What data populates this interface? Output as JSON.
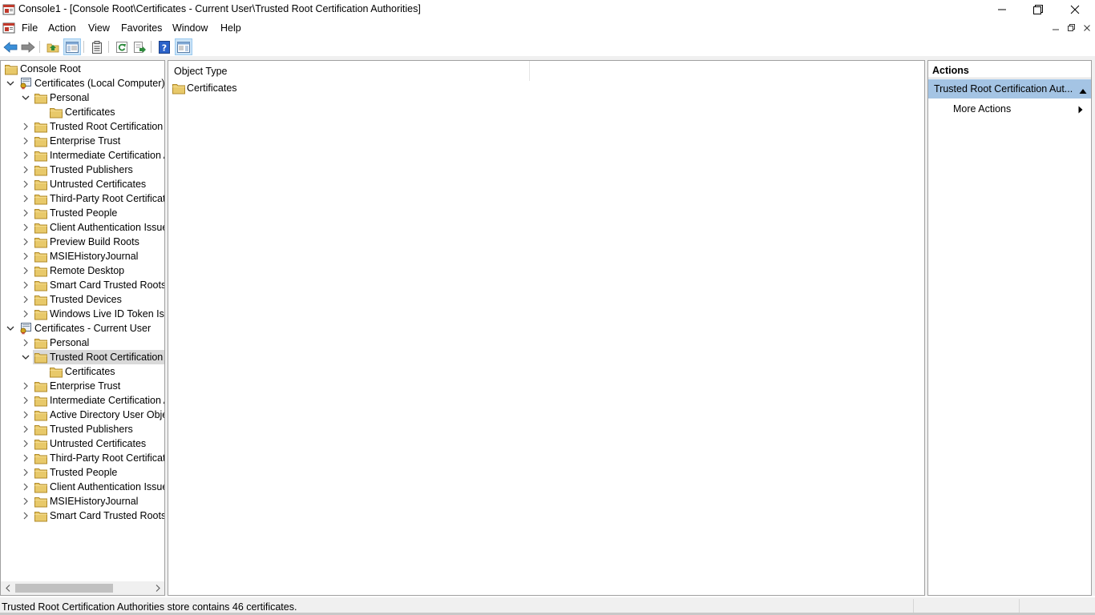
{
  "window": {
    "title": "Console1 - [Console Root\\Certificates - Current User\\Trusted Root Certification Authorities]"
  },
  "menu": [
    "File",
    "Action",
    "View",
    "Favorites",
    "Window",
    "Help"
  ],
  "toolbar": {
    "buttons": [
      "back-icon",
      "forward-icon",
      "up-folder-icon",
      "show-hide-tree-icon",
      "properties-icon",
      "refresh-icon",
      "export-list-icon",
      "help-icon",
      "show-hide-action-pane-icon"
    ]
  },
  "tree": {
    "items": [
      {
        "label": "Console Root",
        "level": 0,
        "expander": "none",
        "icon": "folder"
      },
      {
        "label": "Certificates (Local Computer)",
        "level": 1,
        "expander": "expanded",
        "icon": "cert-store"
      },
      {
        "label": "Personal",
        "level": 2,
        "expander": "expanded",
        "icon": "folder"
      },
      {
        "label": "Certificates",
        "level": 3,
        "expander": "none",
        "icon": "folder"
      },
      {
        "label": "Trusted Root Certification Authorities",
        "level": 2,
        "expander": "collapsed",
        "icon": "folder"
      },
      {
        "label": "Enterprise Trust",
        "level": 2,
        "expander": "collapsed",
        "icon": "folder"
      },
      {
        "label": "Intermediate Certification Authorities",
        "level": 2,
        "expander": "collapsed",
        "icon": "folder"
      },
      {
        "label": "Trusted Publishers",
        "level": 2,
        "expander": "collapsed",
        "icon": "folder"
      },
      {
        "label": "Untrusted Certificates",
        "level": 2,
        "expander": "collapsed",
        "icon": "folder"
      },
      {
        "label": "Third-Party Root Certification Authorities",
        "level": 2,
        "expander": "collapsed",
        "icon": "folder"
      },
      {
        "label": "Trusted People",
        "level": 2,
        "expander": "collapsed",
        "icon": "folder"
      },
      {
        "label": "Client Authentication Issuers",
        "level": 2,
        "expander": "collapsed",
        "icon": "folder"
      },
      {
        "label": "Preview Build Roots",
        "level": 2,
        "expander": "collapsed",
        "icon": "folder"
      },
      {
        "label": "MSIEHistoryJournal",
        "level": 2,
        "expander": "collapsed",
        "icon": "folder"
      },
      {
        "label": "Remote Desktop",
        "level": 2,
        "expander": "collapsed",
        "icon": "folder"
      },
      {
        "label": "Smart Card Trusted Roots",
        "level": 2,
        "expander": "collapsed",
        "icon": "folder"
      },
      {
        "label": "Trusted Devices",
        "level": 2,
        "expander": "collapsed",
        "icon": "folder"
      },
      {
        "label": "Windows Live ID Token Issuer",
        "level": 2,
        "expander": "collapsed",
        "icon": "folder"
      },
      {
        "label": "Certificates - Current User",
        "level": 1,
        "expander": "expanded",
        "icon": "cert-store"
      },
      {
        "label": "Personal",
        "level": 2,
        "expander": "collapsed",
        "icon": "folder"
      },
      {
        "label": "Trusted Root Certification Authorities",
        "level": 2,
        "expander": "expanded",
        "icon": "folder",
        "selected": true
      },
      {
        "label": "Certificates",
        "level": 3,
        "expander": "none",
        "icon": "folder"
      },
      {
        "label": "Enterprise Trust",
        "level": 2,
        "expander": "collapsed",
        "icon": "folder"
      },
      {
        "label": "Intermediate Certification Authorities",
        "level": 2,
        "expander": "collapsed",
        "icon": "folder"
      },
      {
        "label": "Active Directory User Object",
        "level": 2,
        "expander": "collapsed",
        "icon": "folder"
      },
      {
        "label": "Trusted Publishers",
        "level": 2,
        "expander": "collapsed",
        "icon": "folder"
      },
      {
        "label": "Untrusted Certificates",
        "level": 2,
        "expander": "collapsed",
        "icon": "folder"
      },
      {
        "label": "Third-Party Root Certification Authorities",
        "level": 2,
        "expander": "collapsed",
        "icon": "folder"
      },
      {
        "label": "Trusted People",
        "level": 2,
        "expander": "collapsed",
        "icon": "folder"
      },
      {
        "label": "Client Authentication Issuers",
        "level": 2,
        "expander": "collapsed",
        "icon": "folder"
      },
      {
        "label": "MSIEHistoryJournal",
        "level": 2,
        "expander": "collapsed",
        "icon": "folder"
      },
      {
        "label": "Smart Card Trusted Roots",
        "level": 2,
        "expander": "collapsed",
        "icon": "folder"
      }
    ]
  },
  "list": {
    "column_header": "Object Type",
    "rows": [
      {
        "label": "Certificates",
        "icon": "folder"
      }
    ]
  },
  "actions": {
    "title": "Actions",
    "group_label": "Trusted Root Certification Aut...",
    "items": [
      "More Actions"
    ]
  },
  "status": {
    "text": "Trusted Root Certification Authorities store contains 46 certificates."
  },
  "colors": {
    "selected_group": "#a4c4e4",
    "tree_selection": "#d9d9d9",
    "folder": "#e8c96a"
  }
}
